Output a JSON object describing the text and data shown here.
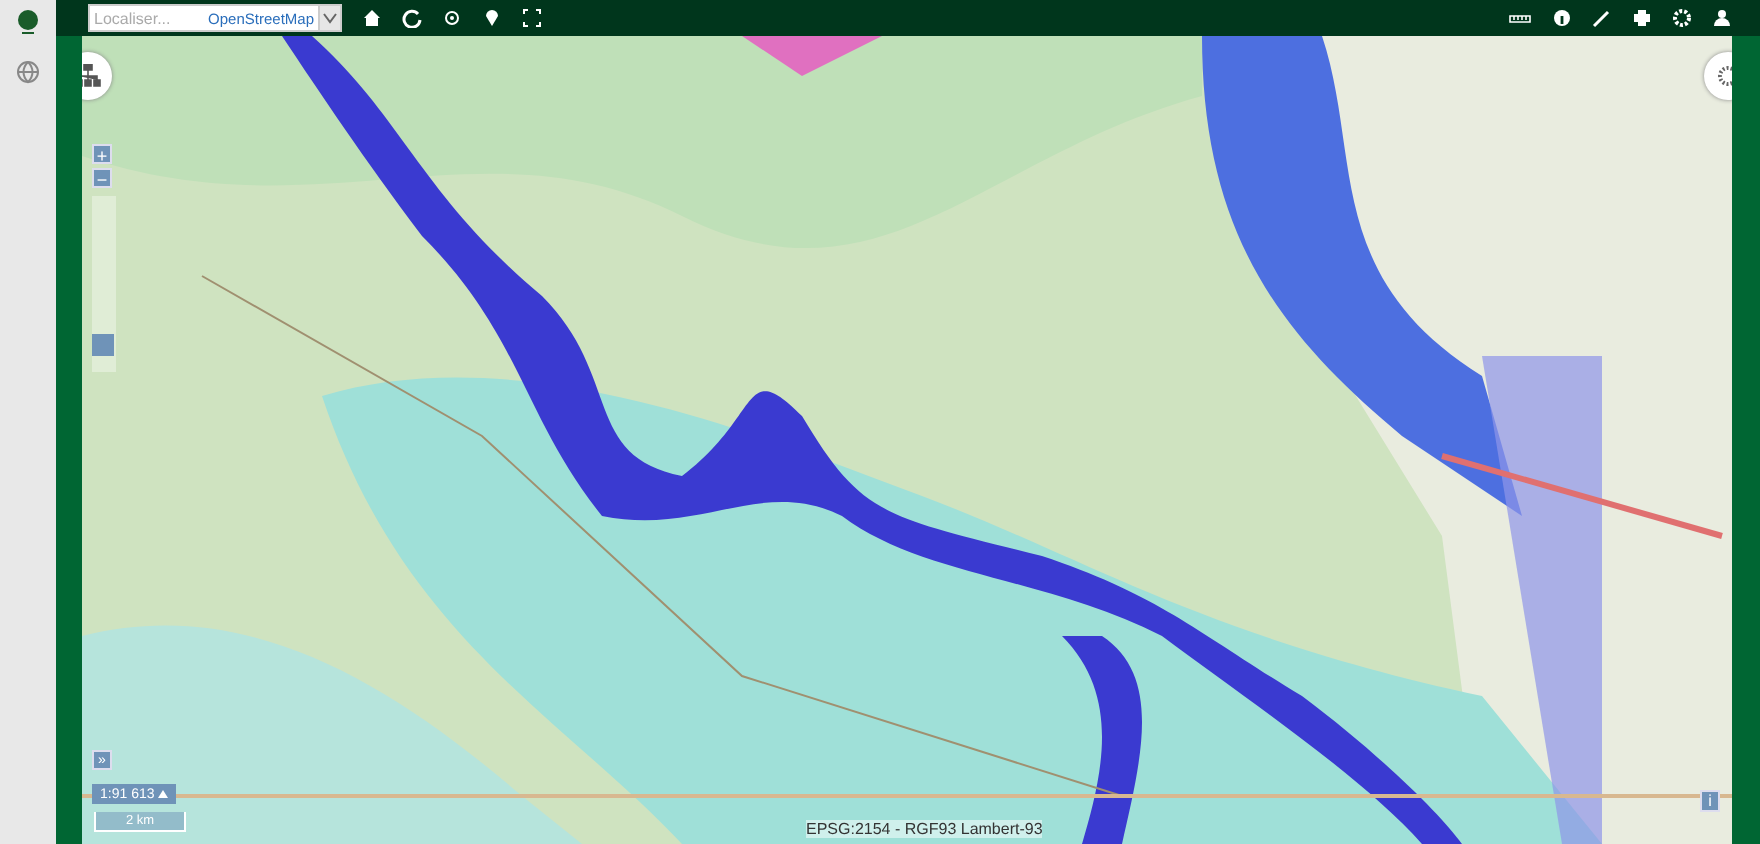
{
  "toolbar": {
    "search": {
      "placeholder": "Localiser..."
    },
    "basemap": {
      "value": "OpenStreetMap"
    }
  },
  "map": {
    "kind": "picture",
    "zoom": {
      "plus": "+",
      "minus": "−",
      "level": 0.1
    },
    "expand_button": "»",
    "scale": "1:91 613",
    "scale_bar": "2 km",
    "projection": "EPSG:2154 - RGF93 Lambert-93",
    "info_button": "i"
  }
}
